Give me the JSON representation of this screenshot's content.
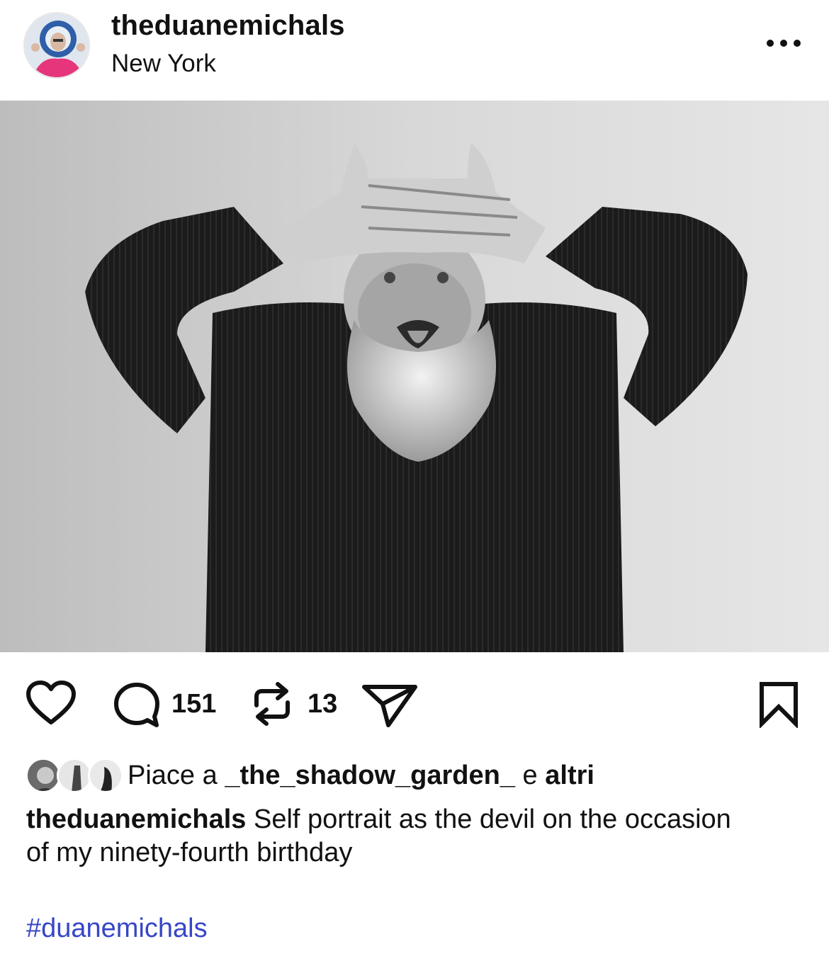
{
  "post": {
    "username": "theduanemichals",
    "location": "New York",
    "photo_alt": "Black and white self portrait"
  },
  "actions": {
    "comments_count": "151",
    "reposts_count": "13"
  },
  "likes": {
    "prefix": "Piace a ",
    "user": "_the_shadow_garden_",
    "middle": " e ",
    "others": "altri"
  },
  "caption": {
    "user": "theduanemichals",
    "text": " Self portrait as the devil on the occasion of my ninety-fourth birthday"
  },
  "hashtag": "#duanemichals",
  "colors": {
    "text": "#111111",
    "hashtag": "#3746c7",
    "background": "#ffffff"
  },
  "icons": [
    "more-icon",
    "heart-icon",
    "comment-icon",
    "repost-icon",
    "share-icon",
    "bookmark-icon"
  ]
}
